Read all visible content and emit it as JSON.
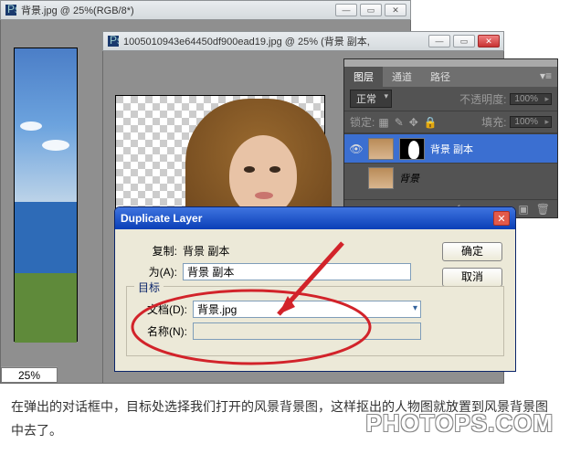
{
  "windows": {
    "bg": {
      "title": "背景.jpg @ 25%(RGB/8*)",
      "zoom": "25%"
    },
    "fg": {
      "title": "1005010943e64450df900ead19.jpg @ 25% (背景 副本,"
    }
  },
  "panel": {
    "tabs": [
      "图层",
      "通道",
      "路径"
    ],
    "blend_mode": "正常",
    "opacity_label": "不透明度:",
    "opacity_value": "100%",
    "lock_label": "锁定:",
    "fill_label": "填充:",
    "fill_value": "100%",
    "layers": [
      {
        "name": "背景 副本",
        "visible": true,
        "selected": true,
        "has_mask": true
      },
      {
        "name": "背景",
        "visible": false,
        "selected": false,
        "italic": true
      }
    ]
  },
  "dialog": {
    "title": "Duplicate Layer",
    "dup_label": "复制:",
    "dup_value": "背景 副本",
    "as_label": "为(A):",
    "as_value": "背景 副本",
    "target_legend": "目标",
    "doc_label": "文档(D):",
    "doc_value": "背景.jpg",
    "name_label": "名称(N):",
    "name_value": "",
    "ok": "确定",
    "cancel": "取消"
  },
  "caption": "在弹出的对话框中，目标处选择我们打开的风景背景图，这样抠出的人物图就放置到风景背景图中去了。",
  "watermark": "PHOTOPS.COM"
}
